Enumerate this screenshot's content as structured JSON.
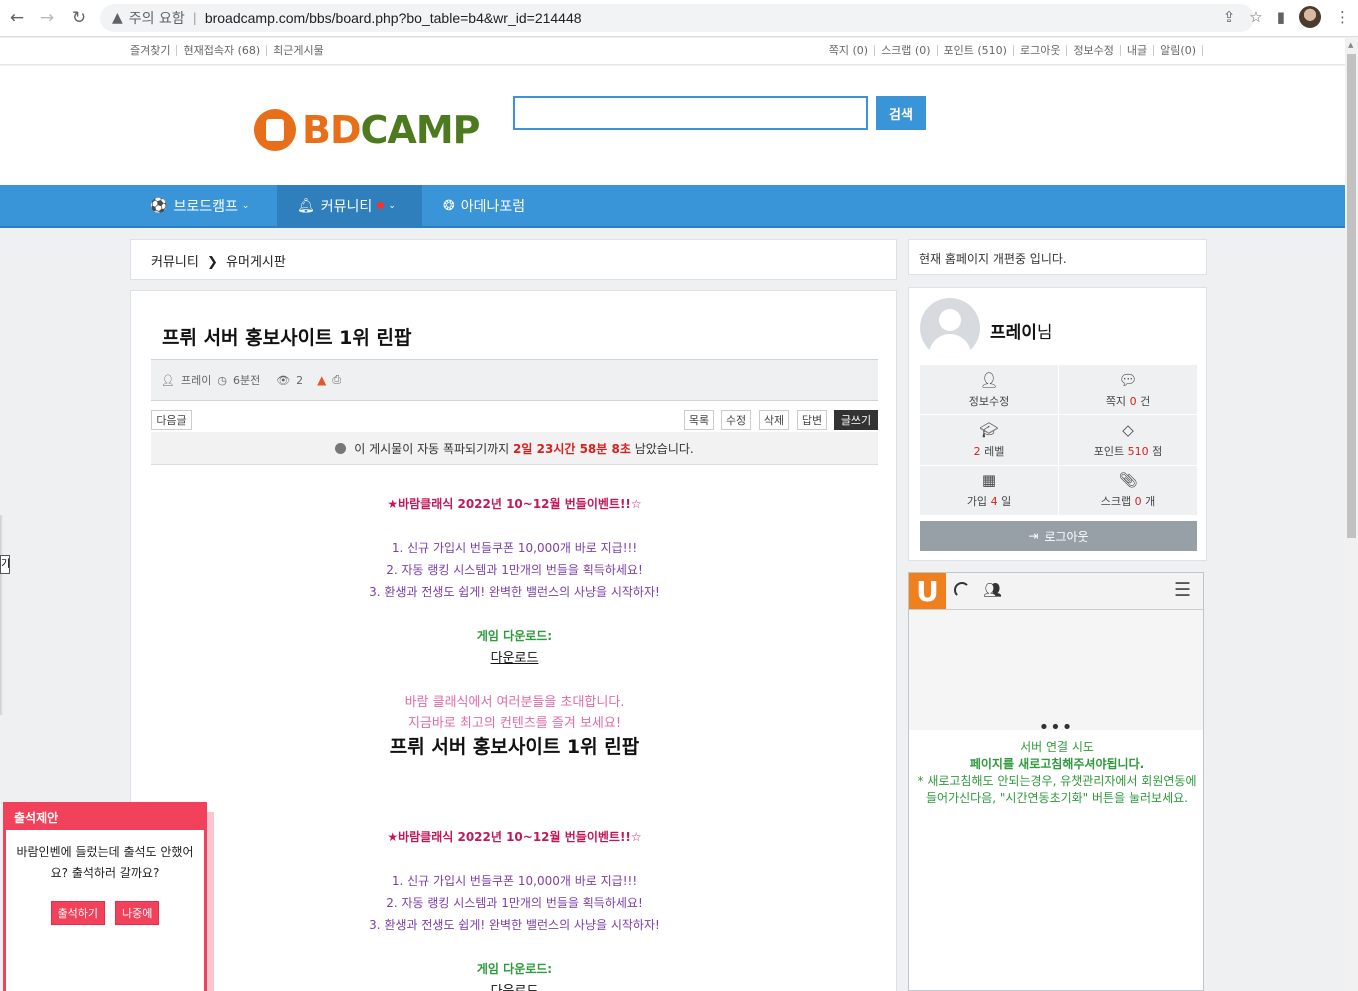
{
  "browser": {
    "warning_label": "주의 요함",
    "url": "broadcamp.com/bbs/board.php?bo_table=b4&wr_id=214448"
  },
  "topbar": {
    "left": [
      "즐겨찾기",
      "현재접속자 (68)",
      "최근게시물"
    ],
    "right": [
      "쪽지 (0)",
      "스크랩 (0)",
      "포인트 (510)",
      "로그아웃",
      "정보수정",
      "내글",
      "알림(0)"
    ]
  },
  "header": {
    "logo_bd": "BD",
    "logo_camp": "CAMP",
    "search_value": "",
    "search_button": "검색"
  },
  "nav": {
    "items": [
      "브로드캠프",
      "커뮤니티",
      "아데나포럼"
    ]
  },
  "breadcrumb": {
    "section": "커뮤니티",
    "board": "유머게시판"
  },
  "notice": "현재 홈페이지 개편중 입니다.",
  "article": {
    "title": "프뤼 서버 홍보사이트 1위 린팝",
    "author": "프레이",
    "time": "6분전",
    "views": "2",
    "next_button": "다음글",
    "buttons": [
      "목록",
      "수정",
      "삭제",
      "답변",
      "글쓰기"
    ],
    "bomb_prefix": "이 게시물이 자동 폭파되기까지",
    "bomb_time": "2일 23시간 58분 8초",
    "bomb_suffix": "남았습니다.",
    "event_title": "★바람클래식 2022년 10~12월 번들이벤트!!☆",
    "lines": [
      "1. 신규 가입시 번들쿠폰 10,000개 바로 지급!!!",
      "2. 자동 랭킹 시스템과 1만개의 번들을 획득하세요!",
      "3. 환생과 전생도 쉽게! 완벽한 밸런스의 사냥을 시작하자!"
    ],
    "download_label": "게임 다운로드:",
    "download_link": "다운로드",
    "invite_1": "바람 클래식에서 여러분들을 초대합니다.",
    "invite_2": "지금바로 최고의 컨텐츠를 즐겨 보세요!",
    "big_title": "프뤼 서버 홍보사이트 1위 린팝"
  },
  "profile": {
    "name": "프레이",
    "suffix": "님",
    "cells": [
      {
        "icon": "user-plus-icon",
        "label": "정보수정"
      },
      {
        "icon": "comment-icon",
        "prefix": "쪽지",
        "num": "0",
        "suffix": "건"
      },
      {
        "icon": "graduation-cap-icon",
        "num": "2",
        "suffix": "레벨"
      },
      {
        "icon": "diamond-icon",
        "prefix": "포인트",
        "num": "510",
        "suffix": "점"
      },
      {
        "icon": "calendar-icon",
        "prefix": "가입",
        "num": "4",
        "suffix": "일"
      },
      {
        "icon": "paperclip-icon",
        "prefix": "스크랩",
        "num": "0",
        "suffix": "개"
      }
    ],
    "logout": "로그아웃"
  },
  "chat": {
    "logo": "U",
    "dots": "•••",
    "status": "서버 연결 시도",
    "msg1": "페이지를 새로고침해주셔야됩니다.",
    "msg2": "* 새로고침해도 안되는경우, 유챗관리자에서 회원연동에 들어가신다음, \"시간연동초기화\" 버튼을 눌러보세요."
  },
  "attendance": {
    "title": "출석제안",
    "body": "바람인벤에 들렀는데 출석도 안했어요? 출석하러 갈까요?",
    "yes": "출석하기",
    "later": "나중에"
  },
  "side_tab": "기",
  "colors": {
    "nav_blue": "#3a95d8",
    "accent_red": "#f2415a",
    "logo_orange": "#e86f1a",
    "logo_green": "#4e7a1f"
  }
}
